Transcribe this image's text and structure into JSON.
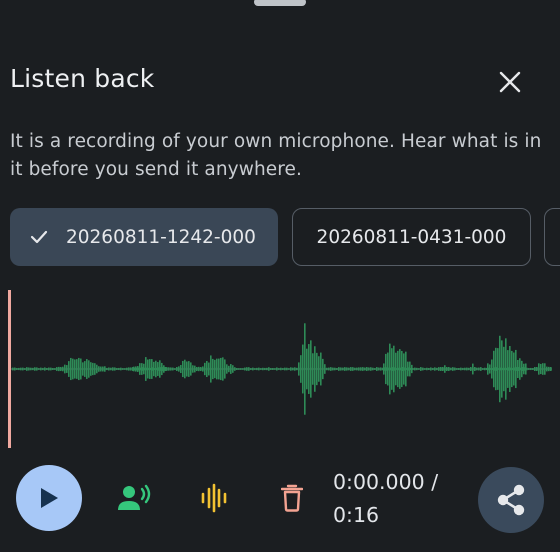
{
  "dialog": {
    "title": "Listen back",
    "description": "It is a recording of your own microphone. Hear what is in it before you send it anywhere."
  },
  "recordings": [
    {
      "label": "20260811-1242-000",
      "selected": true
    },
    {
      "label": "20260811-0431-000",
      "selected": false
    }
  ],
  "player": {
    "position": "0:00.000 /",
    "duration": "0:16",
    "playhead_fraction": 0.0
  },
  "icons": {
    "close": "close-icon",
    "check": "check-icon",
    "play": "play-icon",
    "voice": "voice-icon",
    "waveform": "waveform-icon",
    "delete": "delete-icon",
    "share": "share-icon"
  },
  "colors": {
    "background": "#1b1e21",
    "waveform": "#2e8b57",
    "playhead": "#f0a9a0",
    "chip_selected": "#3a4756",
    "play_button": "#a7c8f7",
    "voice_icon": "#35c77c",
    "waveform_icon": "#f2c232",
    "delete_icon": "#f3a392",
    "share_button": "#3a4a5c"
  }
}
